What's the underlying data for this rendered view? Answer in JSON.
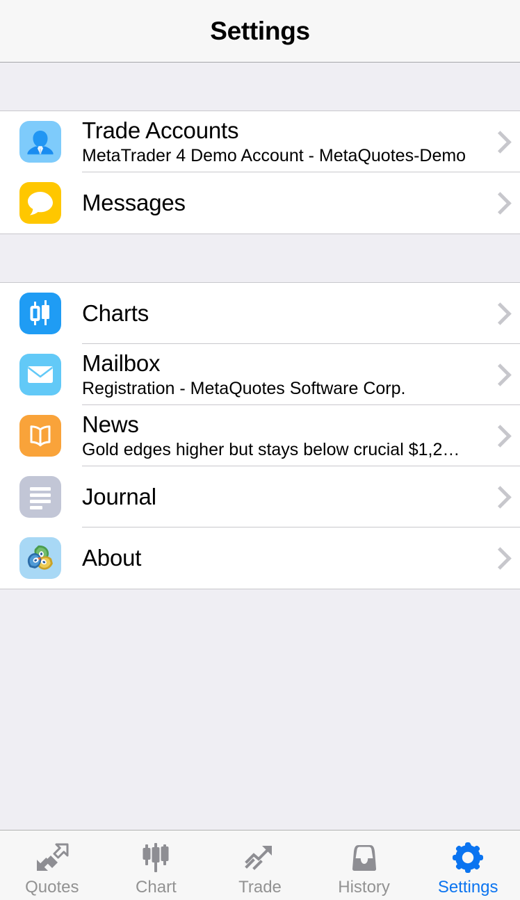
{
  "header": {
    "title": "Settings"
  },
  "colors": {
    "accent": "#0b74f0",
    "tab_inactive": "#929292",
    "nav_background": "#f7f7f7",
    "page_background": "#efeef3",
    "row_background": "#ffffff",
    "separator": "#c8c7cc",
    "chevron": "#c7c7cc",
    "icon_person": "#7ecbfb",
    "icon_messages": "#ffc700",
    "icon_charts": "#1f9cf4",
    "icon_mailbox": "#62c9f7",
    "icon_news": "#f9a33a",
    "icon_journal": "#c2c6d6",
    "icon_about": "#a8d8f5"
  },
  "sections": [
    {
      "rows": [
        {
          "title": "Trade Accounts",
          "subtitle": "MetaTrader 4 Demo Account - MetaQuotes-Demo",
          "icon": "person-icon",
          "accessory": "chevron-right-icon"
        },
        {
          "title": "Messages",
          "subtitle": "",
          "icon": "speech-bubble-icon",
          "accessory": "chevron-right-icon"
        }
      ]
    },
    {
      "rows": [
        {
          "title": "Charts",
          "subtitle": "",
          "icon": "candlestick-icon",
          "accessory": "chevron-right-icon"
        },
        {
          "title": "Mailbox",
          "subtitle": "Registration - MetaQuotes Software Corp.",
          "icon": "envelope-icon",
          "accessory": "chevron-right-icon"
        },
        {
          "title": "News",
          "subtitle": "Gold edges higher but stays below crucial $1,2…",
          "icon": "book-icon",
          "accessory": "chevron-right-icon"
        },
        {
          "title": "Journal",
          "subtitle": "",
          "icon": "document-lines-icon",
          "accessory": "chevron-right-icon"
        },
        {
          "title": "About",
          "subtitle": "",
          "icon": "metaquotes-logo-icon",
          "accessory": "chevron-right-icon"
        }
      ]
    }
  ],
  "tabbar": {
    "active": "Settings",
    "items": [
      {
        "label": "Quotes",
        "icon": "double-arrow-icon"
      },
      {
        "label": "Chart",
        "icon": "candlestick-icon"
      },
      {
        "label": "Trade",
        "icon": "trend-arrow-icon"
      },
      {
        "label": "History",
        "icon": "inbox-tray-icon"
      },
      {
        "label": "Settings",
        "icon": "gear-icon"
      }
    ]
  }
}
